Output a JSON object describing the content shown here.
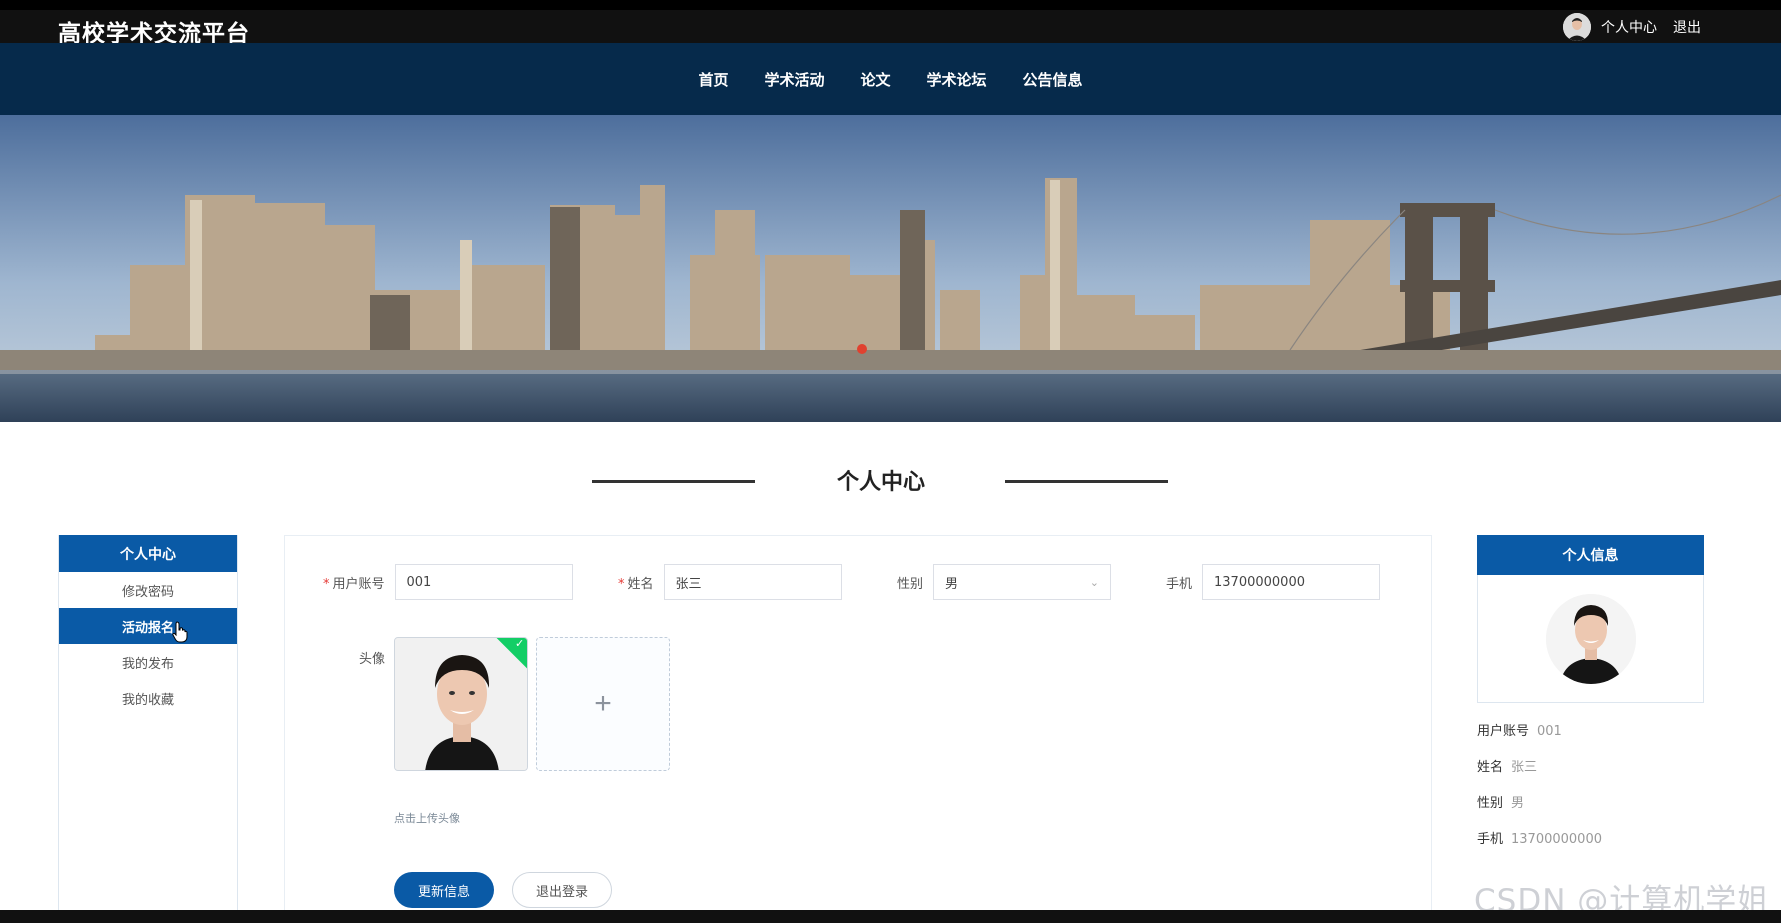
{
  "header": {
    "site_title": "高校学术交流平台",
    "user_center": "个人中心",
    "logout": "退出"
  },
  "nav": {
    "items": [
      "首页",
      "学术活动",
      "论文",
      "学术论坛",
      "公告信息"
    ]
  },
  "section": {
    "title": "个人中心"
  },
  "sidebar": {
    "head": "个人中心",
    "items": [
      "修改密码",
      "活动报名",
      "我的发布",
      "我的收藏"
    ],
    "active": "活动报名"
  },
  "form": {
    "account_label": "用户账号",
    "account_value": "001",
    "name_label": "姓名",
    "name_value": "张三",
    "gender_label": "性别",
    "gender_value": "男",
    "phone_label": "手机",
    "phone_value": "13700000000",
    "avatar_label": "头像",
    "upload_add": "+",
    "upload_tip": "点击上传头像",
    "update_button": "更新信息",
    "logout_button": "退出登录"
  },
  "profile_card": {
    "head": "个人信息",
    "rows": [
      {
        "label": "用户账号",
        "value": "001"
      },
      {
        "label": "姓名",
        "value": "张三"
      },
      {
        "label": "性别",
        "value": "男"
      },
      {
        "label": "手机",
        "value": "13700000000"
      }
    ]
  },
  "watermark": "CSDN @计算机学姐",
  "colors": {
    "topbar": "#111111",
    "nav": "#062a4b",
    "primary": "#0a5aa6",
    "success": "#13ce66"
  }
}
